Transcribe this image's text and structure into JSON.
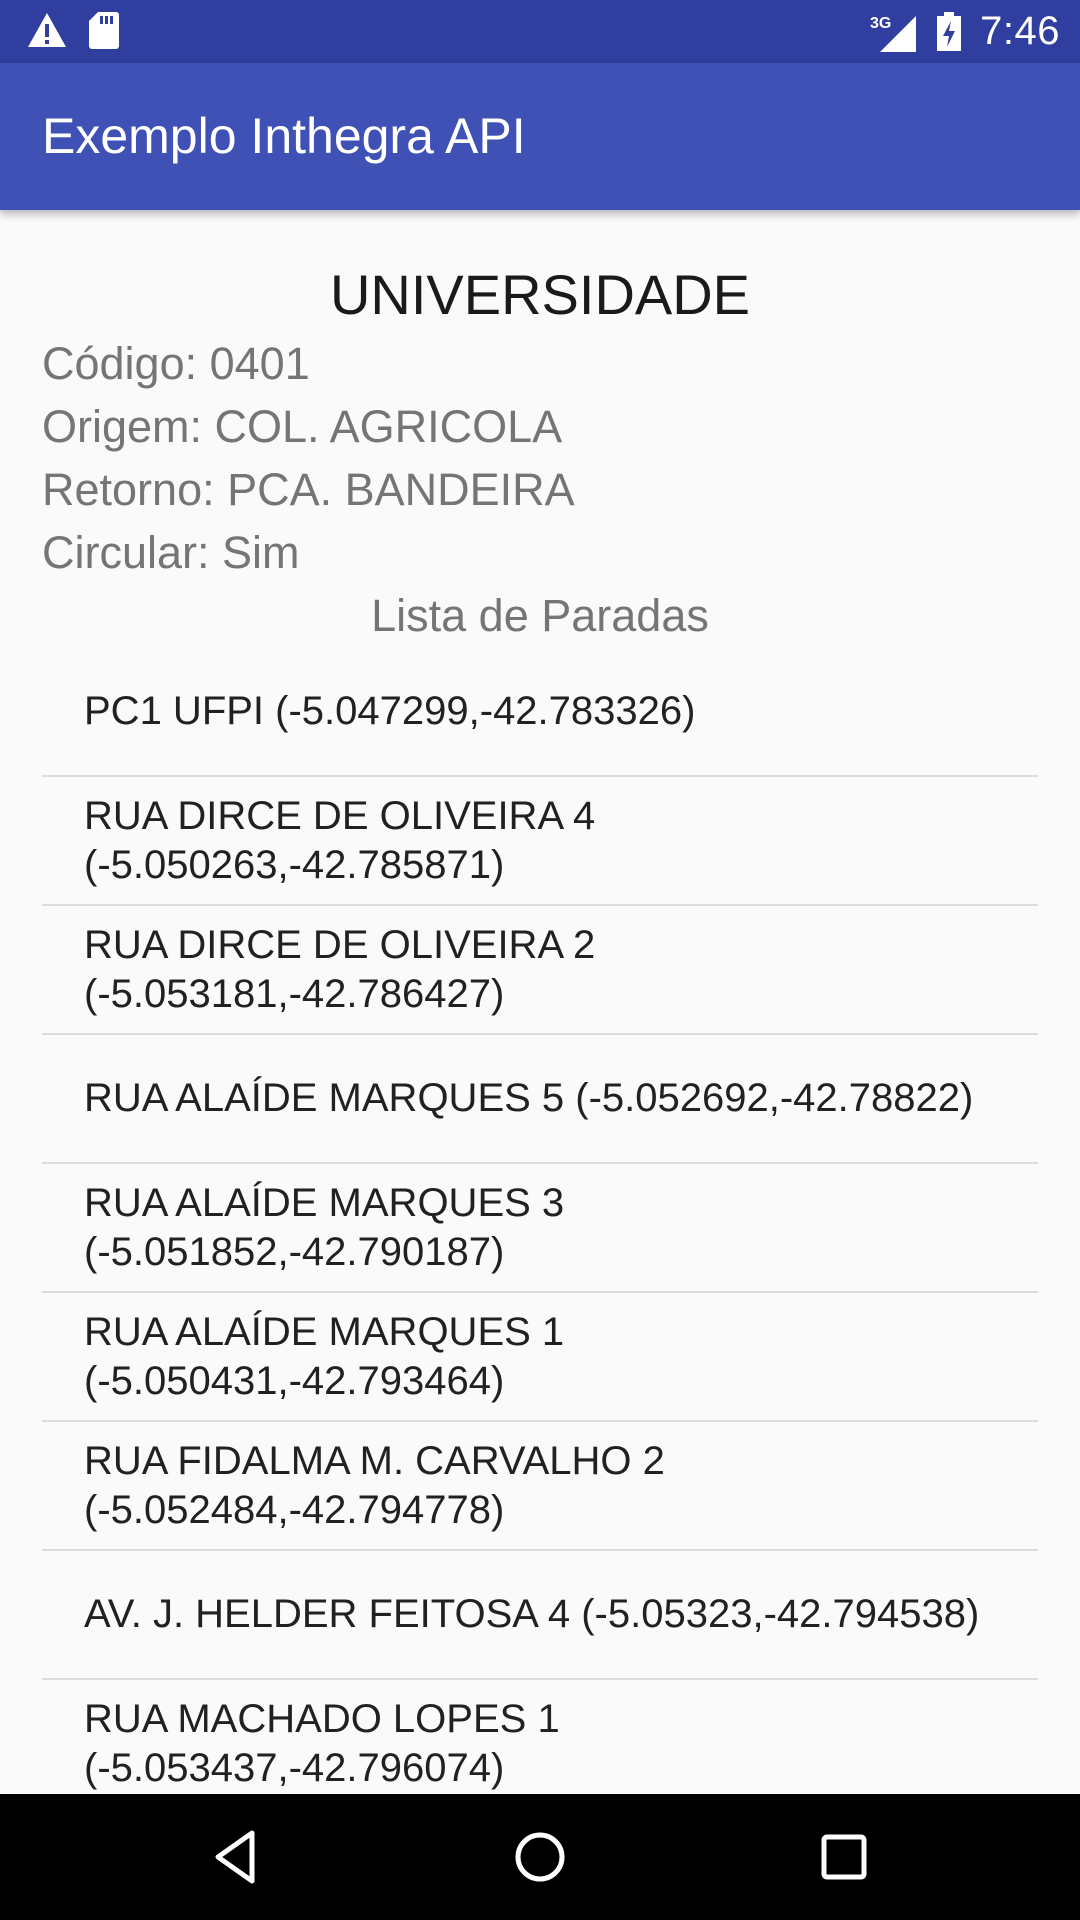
{
  "status_bar": {
    "time": "7:46",
    "network": "3G",
    "icons_left": [
      "warning-icon",
      "sd-card-icon"
    ],
    "icons_right": [
      "signal-3g-icon",
      "battery-icon"
    ]
  },
  "app_bar": {
    "title": "Exemplo Inthegra API"
  },
  "line": {
    "name": "UNIVERSIDADE",
    "codigo": "Código: 0401",
    "origem": "Origem: COL. AGRICOLA",
    "retorno": "Retorno: PCA. BANDEIRA",
    "circular": "Circular: Sim"
  },
  "stops": {
    "title": "Lista de Paradas",
    "items": [
      "PC1 UFPI (-5.047299,-42.783326)",
      "RUA DIRCE DE OLIVEIRA 4\n(-5.050263,-42.785871)",
      "RUA DIRCE DE OLIVEIRA 2\n(-5.053181,-42.786427)",
      "RUA ALAÍDE MARQUES 5  (-5.052692,-42.78822)",
      "RUA ALAÍDE MARQUES 3\n(-5.051852,-42.790187)",
      "RUA ALAÍDE MARQUES 1\n(-5.050431,-42.793464)",
      "RUA FIDALMA M. CARVALHO 2\n(-5.052484,-42.794778)",
      "AV. J. HELDER FEITOSA 4  (-5.05323,-42.794538)",
      "RUA MACHADO LOPES 1\n(-5.053437,-42.796074)"
    ]
  },
  "nav_bar": {
    "buttons": [
      "back-icon",
      "home-icon",
      "recents-icon"
    ]
  }
}
